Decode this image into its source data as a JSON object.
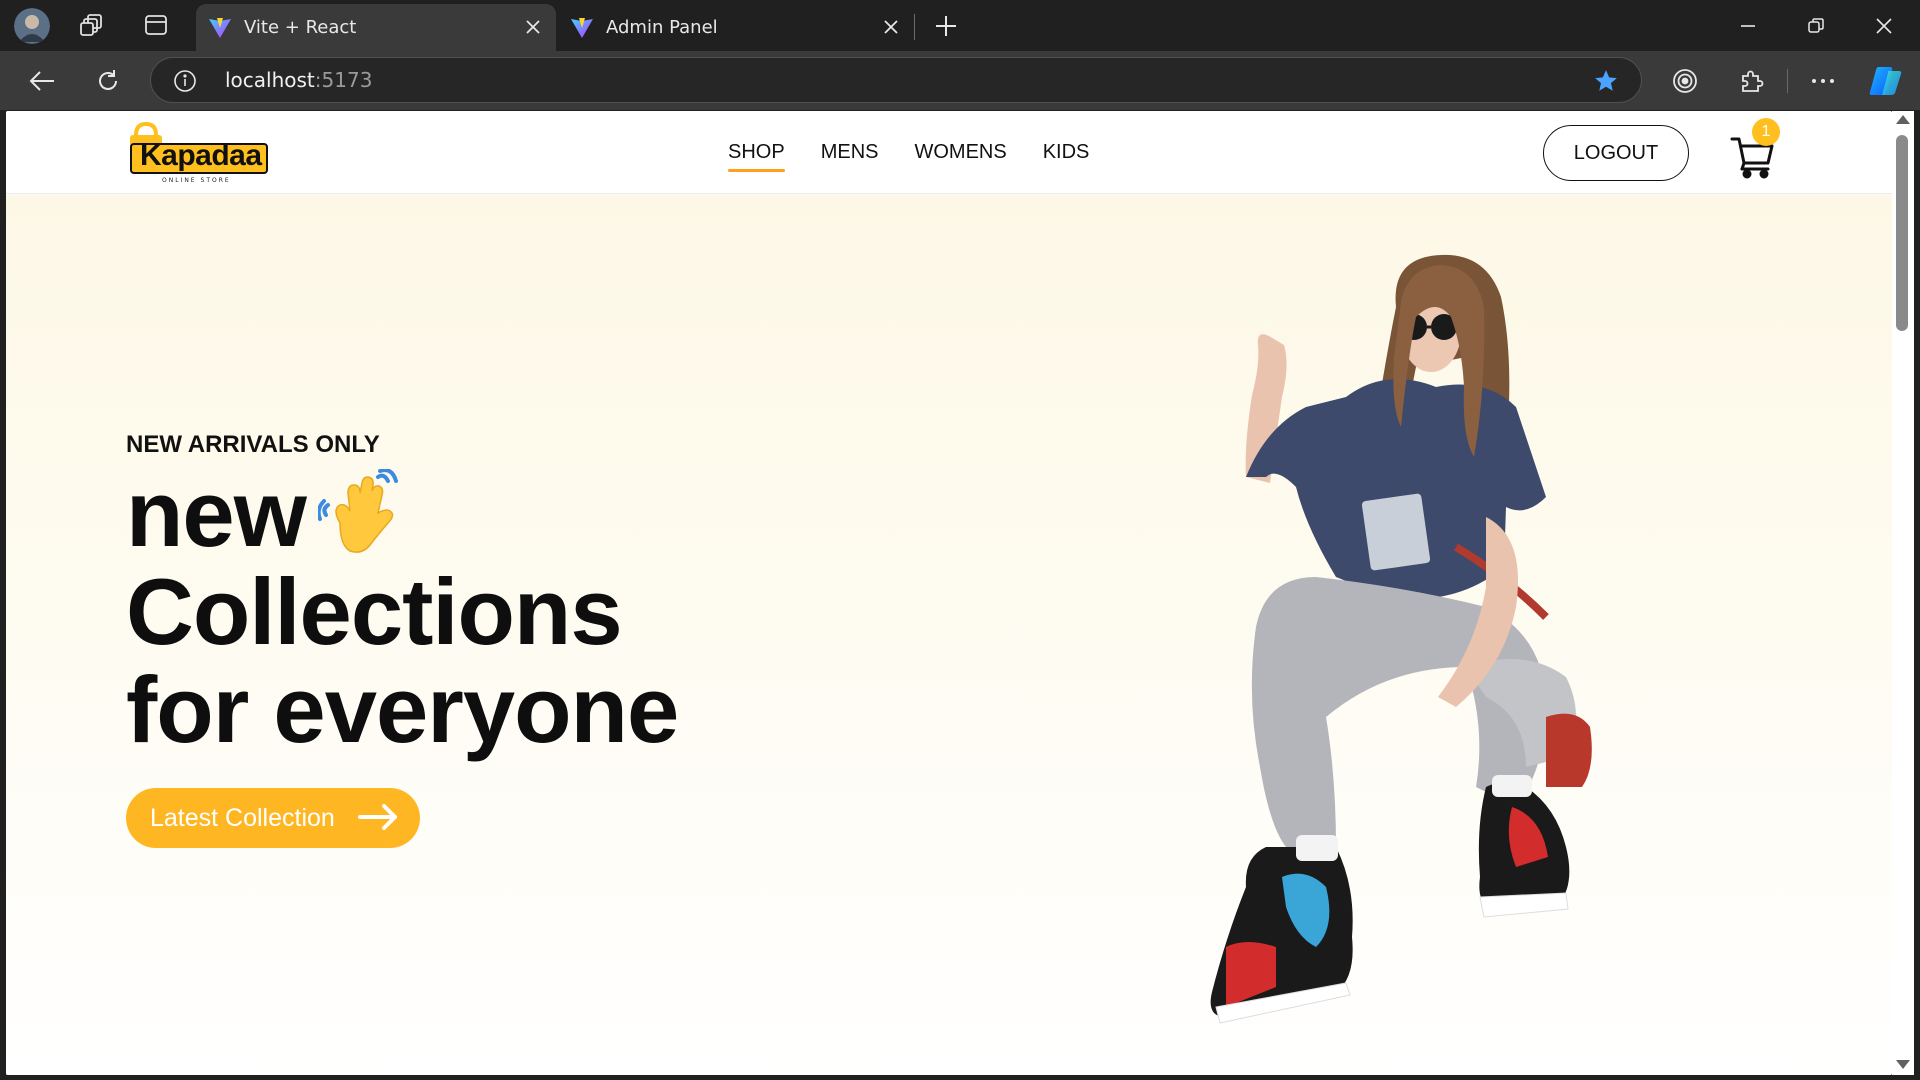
{
  "browser": {
    "tabs": [
      {
        "title": "Vite + React",
        "active": true
      },
      {
        "title": "Admin Panel",
        "active": false
      }
    ],
    "address": {
      "host": "localhost",
      "port": ":5173"
    }
  },
  "site": {
    "logo": {
      "text": "Kapadaa",
      "tagline": "ONLINE STORE"
    },
    "nav": [
      {
        "label": "SHOP",
        "active": true
      },
      {
        "label": "MENS",
        "active": false
      },
      {
        "label": "WOMENS",
        "active": false
      },
      {
        "label": "KIDS",
        "active": false
      }
    ],
    "logout_label": "LOGOUT",
    "cart_count": "1"
  },
  "hero": {
    "eyebrow": "NEW ARRIVALS ONLY",
    "line1": "new",
    "line2": "Collections",
    "line3": "for everyone",
    "cta_label": "Latest Collection"
  },
  "colors": {
    "accent": "#ffb623",
    "nav_underline": "#ff9f1c",
    "hero_bg": "#fdf8e6"
  },
  "icons": [
    "tab-actions-icon",
    "vertical-tabs-icon",
    "vite-icon",
    "close-icon",
    "plus-icon",
    "minimize-icon",
    "restore-icon",
    "back-icon",
    "refresh-icon",
    "info-icon",
    "star-icon",
    "tracking-icon",
    "extensions-icon",
    "more-icon",
    "copilot-icon",
    "cart-icon",
    "arrow-right-icon",
    "waving-hand-icon"
  ]
}
